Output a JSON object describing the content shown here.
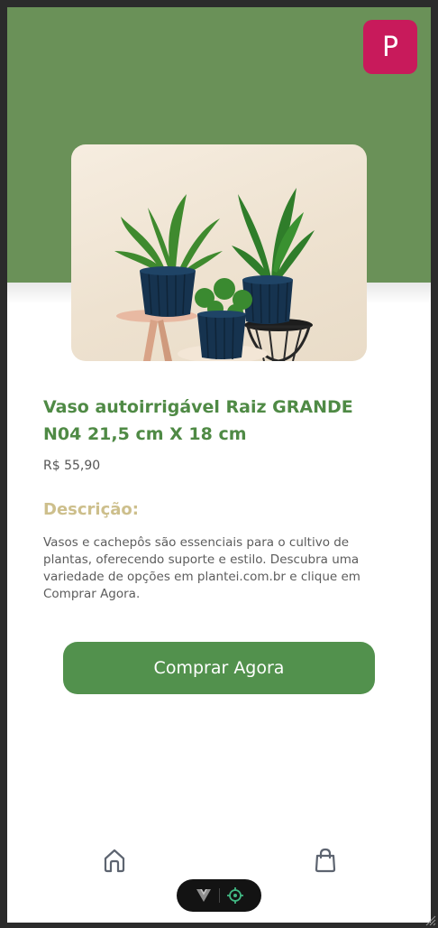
{
  "app": {
    "avatar_letter": "P",
    "brand_color": "#6a9158",
    "accent_color": "#c81a5b"
  },
  "product": {
    "title": "Vaso autoirrigável Raiz GRANDE N04 21,5 cm X 18 cm",
    "price": "R$ 55,90",
    "image_alt": "Vasos com plantas",
    "description_heading": "Descrição:",
    "description": "Vasos e cachepôs são essenciais para o cultivo de plantas, oferecendo suporte e estilo. Descubra uma variedade de opções em plantei.com.br e clique em Comprar Agora."
  },
  "actions": {
    "buy_label": "Comprar Agora",
    "buy_color": "#52914d"
  },
  "bottom_nav": {
    "items": [
      {
        "icon": "home-icon"
      },
      {
        "icon": "shopping-bag-icon"
      }
    ]
  },
  "devtools": {
    "icons": [
      "vue-logo-icon",
      "crosshair-icon"
    ]
  }
}
